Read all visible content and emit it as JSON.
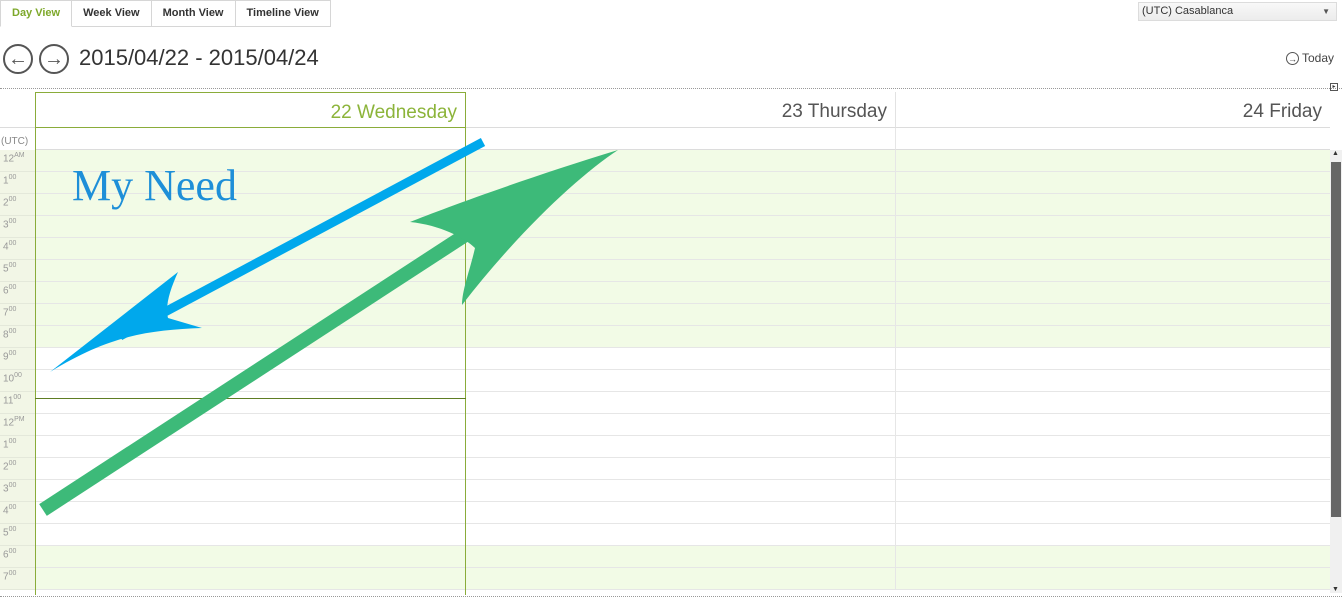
{
  "tabs": [
    {
      "label": "Day View",
      "active": true
    },
    {
      "label": "Week View",
      "active": false
    },
    {
      "label": "Month View",
      "active": false
    },
    {
      "label": "Timeline View",
      "active": false
    }
  ],
  "timezone": {
    "selected": "(UTC) Casablanca"
  },
  "nav": {
    "prev_icon": "arrow-left-circle",
    "next_icon": "arrow-right-circle",
    "date_range": "2015/04/22 - 2015/04/24",
    "today_label": "Today"
  },
  "scheduler": {
    "utc_label": "(UTC)",
    "days": [
      {
        "label": "22 Wednesday",
        "is_today": true
      },
      {
        "label": "23 Thursday",
        "is_today": false
      },
      {
        "label": "24 Friday",
        "is_today": false
      }
    ],
    "hours": [
      {
        "h": "12",
        "s": "AM"
      },
      {
        "h": "1",
        "s": "00"
      },
      {
        "h": "2",
        "s": "00"
      },
      {
        "h": "3",
        "s": "00"
      },
      {
        "h": "4",
        "s": "00"
      },
      {
        "h": "5",
        "s": "00"
      },
      {
        "h": "6",
        "s": "00"
      },
      {
        "h": "7",
        "s": "00"
      },
      {
        "h": "8",
        "s": "00"
      },
      {
        "h": "9",
        "s": "00"
      },
      {
        "h": "10",
        "s": "00"
      },
      {
        "h": "11",
        "s": "00"
      },
      {
        "h": "12",
        "s": "PM"
      },
      {
        "h": "1",
        "s": "00"
      },
      {
        "h": "2",
        "s": "00"
      },
      {
        "h": "3",
        "s": "00"
      },
      {
        "h": "4",
        "s": "00"
      },
      {
        "h": "5",
        "s": "00"
      },
      {
        "h": "6",
        "s": "00"
      },
      {
        "h": "7",
        "s": "00"
      }
    ],
    "work_rows": [
      0,
      1,
      2,
      3,
      4,
      5,
      6,
      7,
      8,
      18,
      19
    ]
  },
  "annotation": {
    "text": "My Need",
    "color_blue": "#00a8ec",
    "color_green": "#3dba79"
  }
}
